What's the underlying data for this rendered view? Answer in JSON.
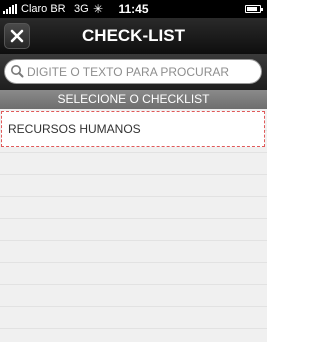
{
  "status_bar": {
    "carrier": "Claro BR",
    "network": "3G",
    "time": "11:45",
    "signal_bars": 5,
    "battery_level": 0.85
  },
  "nav_bar": {
    "title": "CHECK-LIST",
    "close_icon": "close-icon"
  },
  "search": {
    "placeholder": "DIGITE O TEXTO PARA PROCURAR",
    "value": "",
    "icon": "search-icon"
  },
  "section": {
    "header": "SELECIONE O CHECKLIST"
  },
  "list": {
    "items": [
      {
        "label": "RECURSOS HUMANOS"
      }
    ]
  },
  "colors": {
    "status_bar": "#000000",
    "nav_bar": "#1c1c1c",
    "section_header": "#7c7c7c",
    "selected_border": "#e05a5a",
    "list_background": "#f0f0f0"
  }
}
